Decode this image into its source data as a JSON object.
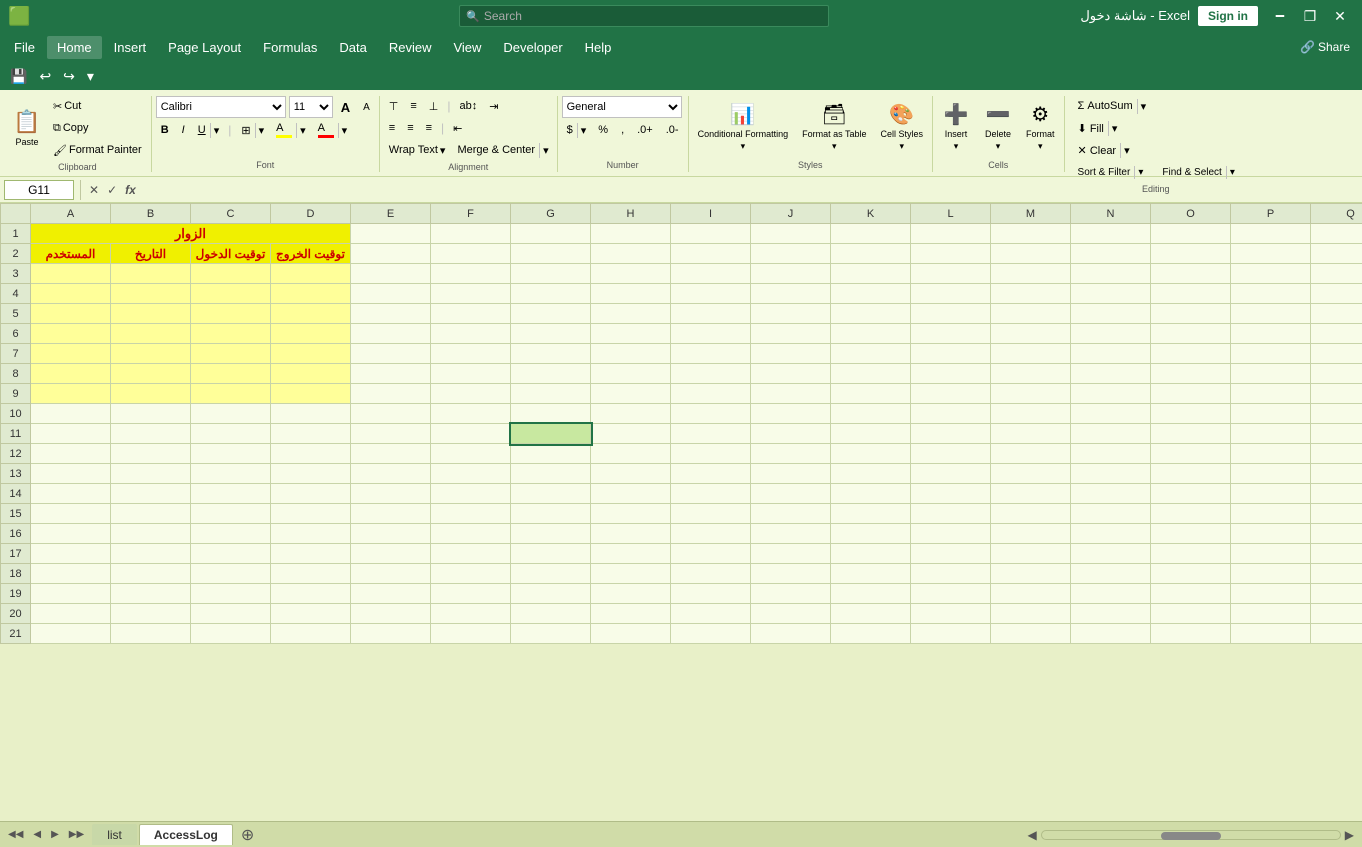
{
  "titleBar": {
    "title": "شاشة دخول - Excel",
    "searchPlaceholder": "Search",
    "signInLabel": "Sign in",
    "minimize": "🗕",
    "maximize": "🗗",
    "restore": "❐",
    "close": "✕"
  },
  "menuBar": {
    "items": [
      "File",
      "Home",
      "Insert",
      "Page Layout",
      "Formulas",
      "Data",
      "Review",
      "View",
      "Developer",
      "Help"
    ],
    "activeItem": "Home",
    "shareLabel": "Share"
  },
  "quickAccess": {
    "save": "💾",
    "undo": "↩",
    "redo": "↪",
    "more": "▾"
  },
  "ribbon": {
    "clipboard": {
      "label": "Clipboard",
      "paste": "Paste",
      "cut": "✂",
      "copy": "⧉",
      "formatPainter": "🖌"
    },
    "font": {
      "label": "Font",
      "fontName": "Calibri",
      "fontSize": "11",
      "bold": "B",
      "italic": "I",
      "underline": "U",
      "increaseFont": "A",
      "decreaseFont": "A",
      "borders": "⊞",
      "fillColor": "A",
      "fontColor": "A"
    },
    "alignment": {
      "label": "Alignment",
      "topAlign": "⊤",
      "midAlign": "≡",
      "botAlign": "⊥",
      "leftAlign": "≡",
      "centerAlign": "≡",
      "rightAlign": "≡",
      "decreaseIndent": "⇤",
      "increaseIndent": "⇥",
      "wrapText": "Wrap Text",
      "mergeCenterText": "Merge & Center",
      "orientationIcon": "ab",
      "moreIcon": "⌄"
    },
    "number": {
      "label": "Number",
      "format": "General",
      "dollar": "$",
      "percent": "%",
      "comma": ",",
      "increase": ".0",
      "decrease": ".00"
    },
    "styles": {
      "label": "Styles",
      "conditionalFormatting": "Conditional Formatting",
      "formatAsTable": "Format as Table",
      "cellStyles": "Cell Styles"
    },
    "cells": {
      "label": "Cells",
      "insert": "Insert",
      "delete": "Delete",
      "format": "Format"
    },
    "editing": {
      "label": "Editing",
      "autoSum": "AutoSum",
      "fill": "Fill",
      "clear": "Clear",
      "sortFilter": "Sort & Filter",
      "findSelect": "Find & Select"
    }
  },
  "formulaBar": {
    "cellRef": "G11",
    "cancelIcon": "✕",
    "confirmIcon": "✓",
    "functionIcon": "fx",
    "formula": ""
  },
  "spreadsheet": {
    "columns": [
      "",
      "A",
      "B",
      "C",
      "D",
      "E",
      "F",
      "G",
      "H",
      "I",
      "J",
      "K",
      "L",
      "M",
      "N",
      "O",
      "P",
      "Q"
    ],
    "rows": [
      {
        "num": 1,
        "cells": {
          "A": "الزوار",
          "B": "",
          "C": "",
          "D": "",
          "type": "title",
          "span": 4
        }
      },
      {
        "num": 2,
        "cells": {
          "A": "المستخدم",
          "B": "التاريخ",
          "C": "توقيت الدخول",
          "D": "توقيت الخروج"
        },
        "type": "header"
      },
      {
        "num": 3,
        "cells": {
          "A": "",
          "B": "",
          "C": "",
          "D": ""
        },
        "type": "data"
      },
      {
        "num": 4,
        "cells": {
          "A": "",
          "B": "",
          "C": "",
          "D": ""
        },
        "type": "data"
      },
      {
        "num": 5,
        "cells": {
          "A": "",
          "B": "",
          "C": "",
          "D": ""
        },
        "type": "data"
      },
      {
        "num": 6,
        "cells": {
          "A": "",
          "B": "",
          "C": "",
          "D": ""
        },
        "type": "data"
      },
      {
        "num": 7,
        "cells": {
          "A": "",
          "B": "",
          "C": "",
          "D": ""
        },
        "type": "data"
      },
      {
        "num": 8,
        "cells": {
          "A": "",
          "B": "",
          "C": "",
          "D": ""
        },
        "type": "data"
      },
      {
        "num": 9,
        "cells": {
          "A": "",
          "B": "",
          "C": "",
          "D": ""
        },
        "type": "data"
      },
      {
        "num": 10,
        "cells": {}
      },
      {
        "num": 11,
        "cells": {}
      },
      {
        "num": 12,
        "cells": {}
      },
      {
        "num": 13,
        "cells": {}
      },
      {
        "num": 14,
        "cells": {}
      },
      {
        "num": 15,
        "cells": {}
      },
      {
        "num": 16,
        "cells": {}
      },
      {
        "num": 17,
        "cells": {}
      },
      {
        "num": 18,
        "cells": {}
      },
      {
        "num": 19,
        "cells": {}
      },
      {
        "num": 20,
        "cells": {}
      },
      {
        "num": 21,
        "cells": {}
      }
    ]
  },
  "sheets": {
    "tabs": [
      "list",
      "AccessLog"
    ],
    "activeTab": "AccessLog"
  },
  "selectedCell": "G11"
}
